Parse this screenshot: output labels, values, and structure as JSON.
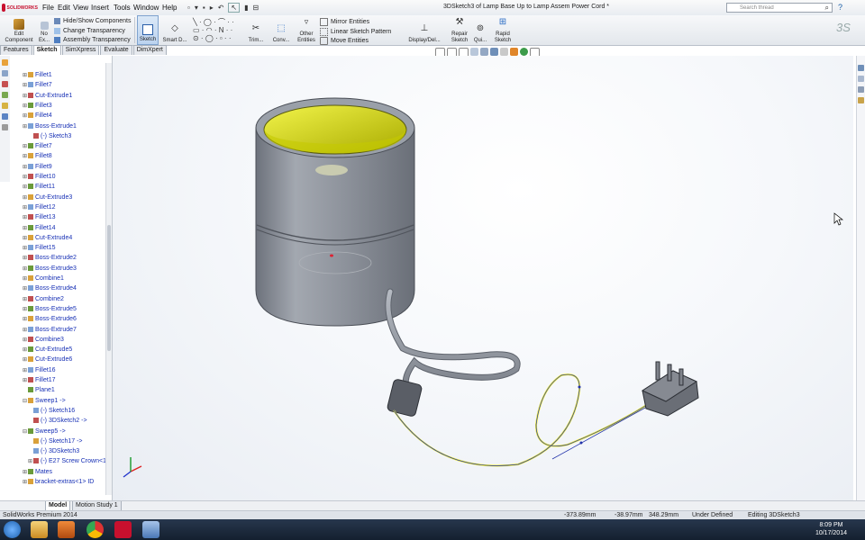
{
  "app": {
    "logo_text": "SOLIDWORKS",
    "window_title": "3DSketch3 of Lamp Base Up to Lamp Assem Power Cord *",
    "search_placeholder": "Search thread",
    "help_label": "?"
  },
  "menu": [
    "File",
    "Edit",
    "View",
    "Insert",
    "Tools",
    "Window",
    "Help"
  ],
  "command_manager": {
    "edit_component": "Edit\nComponent",
    "no_external": "No\nEx...",
    "hide_show": "Hide/Show Components",
    "change_transparency": "Change Transparency",
    "assembly_transparency": "Assembly Transparency",
    "sketch": "Sketch",
    "smart_dim": "Smart D...",
    "trim": "Trim...",
    "convert": "Conv...",
    "other_entities": "Other\nEntities",
    "mirror_entities": "Mirror Entities",
    "linear_pattern": "Linear Sketch Pattern",
    "move_entities": "Move Entities",
    "display_delete": "Display/Del...",
    "repair_sketch": "Repair\nSketch",
    "quick_snaps": "Qui...",
    "rapid_sketch": "Rapid\nSketch"
  },
  "cmd_tabs": [
    "Features",
    "Sketch",
    "SimXpress",
    "Evaluate",
    "DimXpert"
  ],
  "tree": [
    {
      "label": "Fillet1",
      "expand": "⊞"
    },
    {
      "label": "Fillet7",
      "expand": "⊞"
    },
    {
      "label": "Cut-Extrude1",
      "expand": "⊞"
    },
    {
      "label": "Fillet3",
      "expand": "⊞"
    },
    {
      "label": "Fillet4",
      "expand": "⊞"
    },
    {
      "label": "Boss-Extrude1",
      "expand": "⊞"
    },
    {
      "label": "(-) Sketch3",
      "expand": ""
    },
    {
      "label": "Fillet7",
      "expand": "⊞"
    },
    {
      "label": "Fillet8",
      "expand": "⊞"
    },
    {
      "label": "Fillet9",
      "expand": "⊞"
    },
    {
      "label": "Fillet10",
      "expand": "⊞"
    },
    {
      "label": "Fillet11",
      "expand": "⊞"
    },
    {
      "label": "Cut-Extrude3",
      "expand": "⊞"
    },
    {
      "label": "Fillet12",
      "expand": "⊞"
    },
    {
      "label": "Fillet13",
      "expand": "⊞"
    },
    {
      "label": "Fillet14",
      "expand": "⊞"
    },
    {
      "label": "Cut-Extrude4",
      "expand": "⊞"
    },
    {
      "label": "Fillet15",
      "expand": "⊞"
    },
    {
      "label": "Boss-Extrude2",
      "expand": "⊞"
    },
    {
      "label": "Boss-Extrude3",
      "expand": "⊞"
    },
    {
      "label": "Combine1",
      "expand": "⊞"
    },
    {
      "label": "Boss-Extrude4",
      "expand": "⊞"
    },
    {
      "label": "Combine2",
      "expand": "⊞"
    },
    {
      "label": "Boss-Extrude5",
      "expand": "⊞"
    },
    {
      "label": "Boss-Extrude6",
      "expand": "⊞"
    },
    {
      "label": "Boss-Extrude7",
      "expand": "⊞"
    },
    {
      "label": "Combine3",
      "expand": "⊞"
    },
    {
      "label": "Cut-Extrude5",
      "expand": "⊞"
    },
    {
      "label": "Cut-Extrude6",
      "expand": "⊞"
    },
    {
      "label": "Fillet16",
      "expand": "⊞"
    },
    {
      "label": "Fillet17",
      "expand": "⊞"
    },
    {
      "label": "Plane1",
      "expand": ""
    },
    {
      "label": "Sweep1 ->",
      "expand": "⊟"
    },
    {
      "label": "(-) Sketch16",
      "expand": ""
    },
    {
      "label": "(-) 3DSketch2 ->",
      "expand": ""
    },
    {
      "label": "Sweep5 ->",
      "expand": "⊟"
    },
    {
      "label": "(-) Sketch17 ->",
      "expand": ""
    },
    {
      "label": "(-) 3DSketch3",
      "expand": ""
    },
    {
      "label": "(-) E27 Screw Crown<1",
      "expand": "⊞"
    },
    {
      "label": "Mates",
      "expand": "⊞"
    },
    {
      "label": "bracket-extras<1> ID",
      "expand": "⊞"
    }
  ],
  "bottom_tabs": [
    "Model",
    "Motion Study 1"
  ],
  "status": {
    "product": "SolidWorks Premium 2014",
    "x": "-373.89mm",
    "y": "-38.97mm",
    "z": "348.29mm",
    "state": "Under Defined",
    "editing": "Editing 3DSketch3"
  },
  "clock": {
    "time": "8:09 PM",
    "date": "10/17/2014"
  },
  "colors": {
    "accent": "#c8102e",
    "tree_text": "#1730b5",
    "body_gray": "#8e939c",
    "inner_yellow": "#e1e400",
    "sketch_yellow": "#f1ee30",
    "sketch_blue": "#2233aa"
  },
  "icons": [
    "search-icon",
    "sketch-icon",
    "help-icon"
  ]
}
